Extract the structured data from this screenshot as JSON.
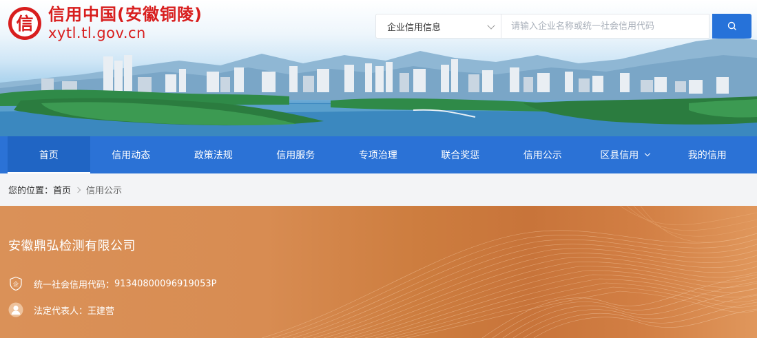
{
  "header": {
    "logo_glyph": "信",
    "site_title": "信用中国(安徽铜陵)",
    "site_url": "xytl.tl.gov.cn"
  },
  "search": {
    "category_selected": "企业信用信息",
    "placeholder": "请输入企业名称或统一社会信用代码",
    "button_icon": "search-icon"
  },
  "nav": {
    "items": [
      {
        "label": "首页"
      },
      {
        "label": "信用动态"
      },
      {
        "label": "政策法规"
      },
      {
        "label": "信用服务"
      },
      {
        "label": "专项治理"
      },
      {
        "label": "联合奖惩"
      },
      {
        "label": "信用公示"
      },
      {
        "label": "区县信用"
      },
      {
        "label": "我的信用"
      }
    ]
  },
  "breadcrumb": {
    "prefix": "您的位置：",
    "home": "首页",
    "current": "信用公示"
  },
  "company": {
    "name": "安徽鼎弘检测有限公司",
    "credit_code_label": "统一社会信用代码：",
    "credit_code": "91340800096919053P",
    "legal_rep_label": "法定代表人：",
    "legal_rep": "王建营"
  },
  "colors": {
    "brand_red": "#d81e1e",
    "nav_blue": "#2b72d6",
    "search_blue": "#2672d9",
    "panel_orange": "#d0813f"
  }
}
